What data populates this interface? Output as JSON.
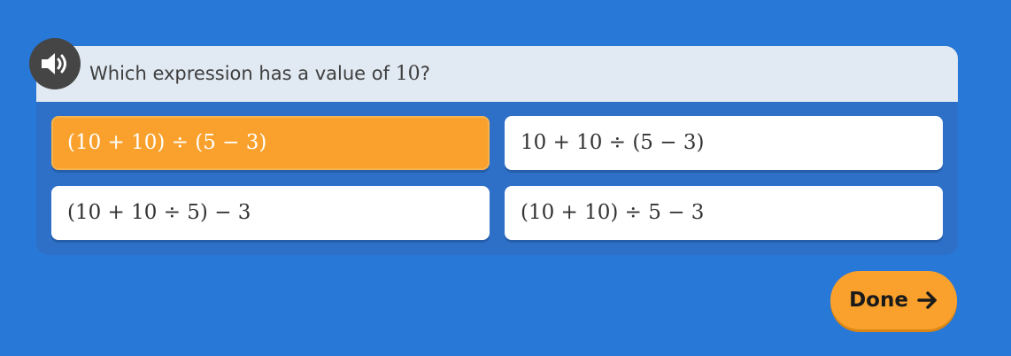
{
  "question": {
    "prefix": "Which expression has a value of ",
    "number": "10",
    "suffix": "?"
  },
  "options": [
    {
      "text": "(10 + 10) ÷ (5 − 3)",
      "selected": true
    },
    {
      "text": "10 + 10 ÷ (5 − 3)",
      "selected": false
    },
    {
      "text": "(10 + 10 ÷ 5) − 3",
      "selected": false
    },
    {
      "text": "(10 + 10) ÷ 5 − 3",
      "selected": false
    }
  ],
  "done_button": {
    "label": "Done",
    "icon": "arrow-right-icon"
  },
  "speaker": {
    "icon": "speaker-icon"
  },
  "colors": {
    "background": "#2878d8",
    "card": "#2e70c7",
    "question_bar": "#e1e9f2",
    "selected": "#f9a12c",
    "speaker": "#454545"
  }
}
